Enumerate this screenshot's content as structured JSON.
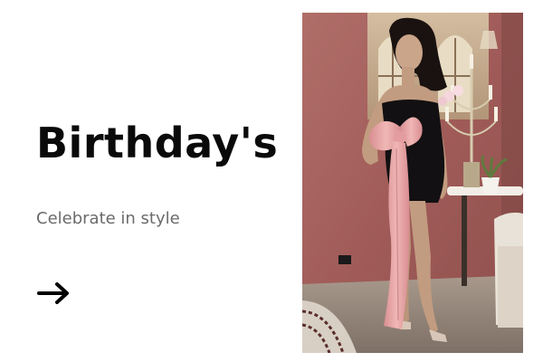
{
  "banner": {
    "headline": "Birthday's",
    "subheadline": "Celebrate in style",
    "cta_icon": "arrow-right-icon",
    "photo": {
      "subject": "model-in-black-velvet-strapless-dress-with-pink-satin-bow",
      "colors": {
        "wall": "#a8625f",
        "dress": "#121012",
        "bow": "#e8a8a8",
        "floor": "#9a8a7e",
        "skin": "#caa58a",
        "hair": "#1a1210"
      }
    }
  }
}
